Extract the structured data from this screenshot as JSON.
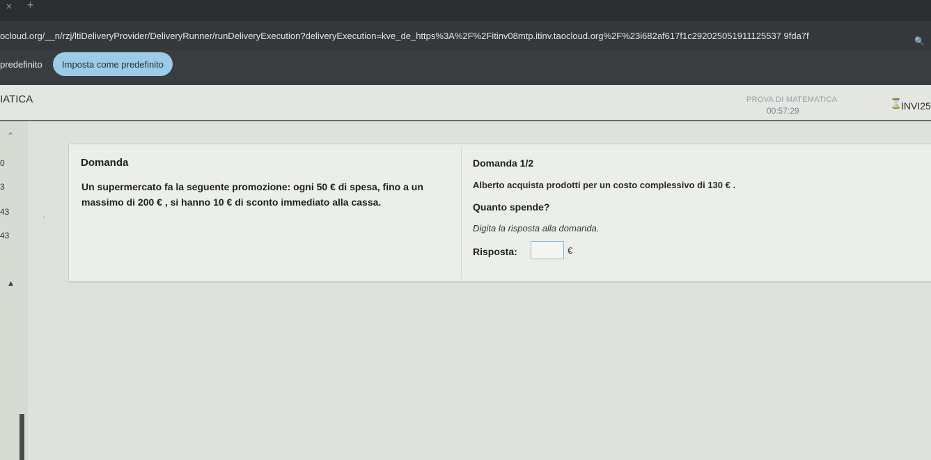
{
  "browser": {
    "tab_close": "×",
    "tab_new": "+",
    "url": "ocloud.org/__n/rzj/ltiDeliveryProvider/DeliveryRunner/runDeliveryExecution?deliveryExecution=kve_de_https%3A%2F%2Fitinv08mtp.itinv.taocloud.org%2F%23i682af617f1c292025051911125537 9fda7f",
    "search_icon": "🔍"
  },
  "infobar": {
    "text": "predefinito",
    "button_label": "Imposta come predefinito"
  },
  "header": {
    "title": "IATICA",
    "test_name": "PROVA DI MATEMATICA",
    "timer": "00:57:29",
    "send_icon": "⌛",
    "send_label": "INVI25"
  },
  "nav": {
    "chevron": "⌃",
    "items": [
      "0",
      "3",
      "43",
      "43"
    ],
    "triangle": "▲",
    "collapse_arrow": "‹"
  },
  "stimulus": {
    "title": "Domanda",
    "text": "Un supermercato fa la seguente promozione: ogni 50 € di spesa, fino a un massimo di 200 € , si hanno 10 € di sconto immediato alla cassa."
  },
  "question": {
    "title": "Domanda 1/2",
    "text": "Alberto acquista prodotti per un costo complessivo di 130 € .",
    "ask": "Quanto spende?",
    "hint": "Digita la risposta alla domanda.",
    "answer_label": "Risposta:",
    "answer_value": "",
    "answer_unit": "€"
  },
  "colors": {
    "accent": "#9ccbe6",
    "input_border": "#8fb7d3"
  }
}
